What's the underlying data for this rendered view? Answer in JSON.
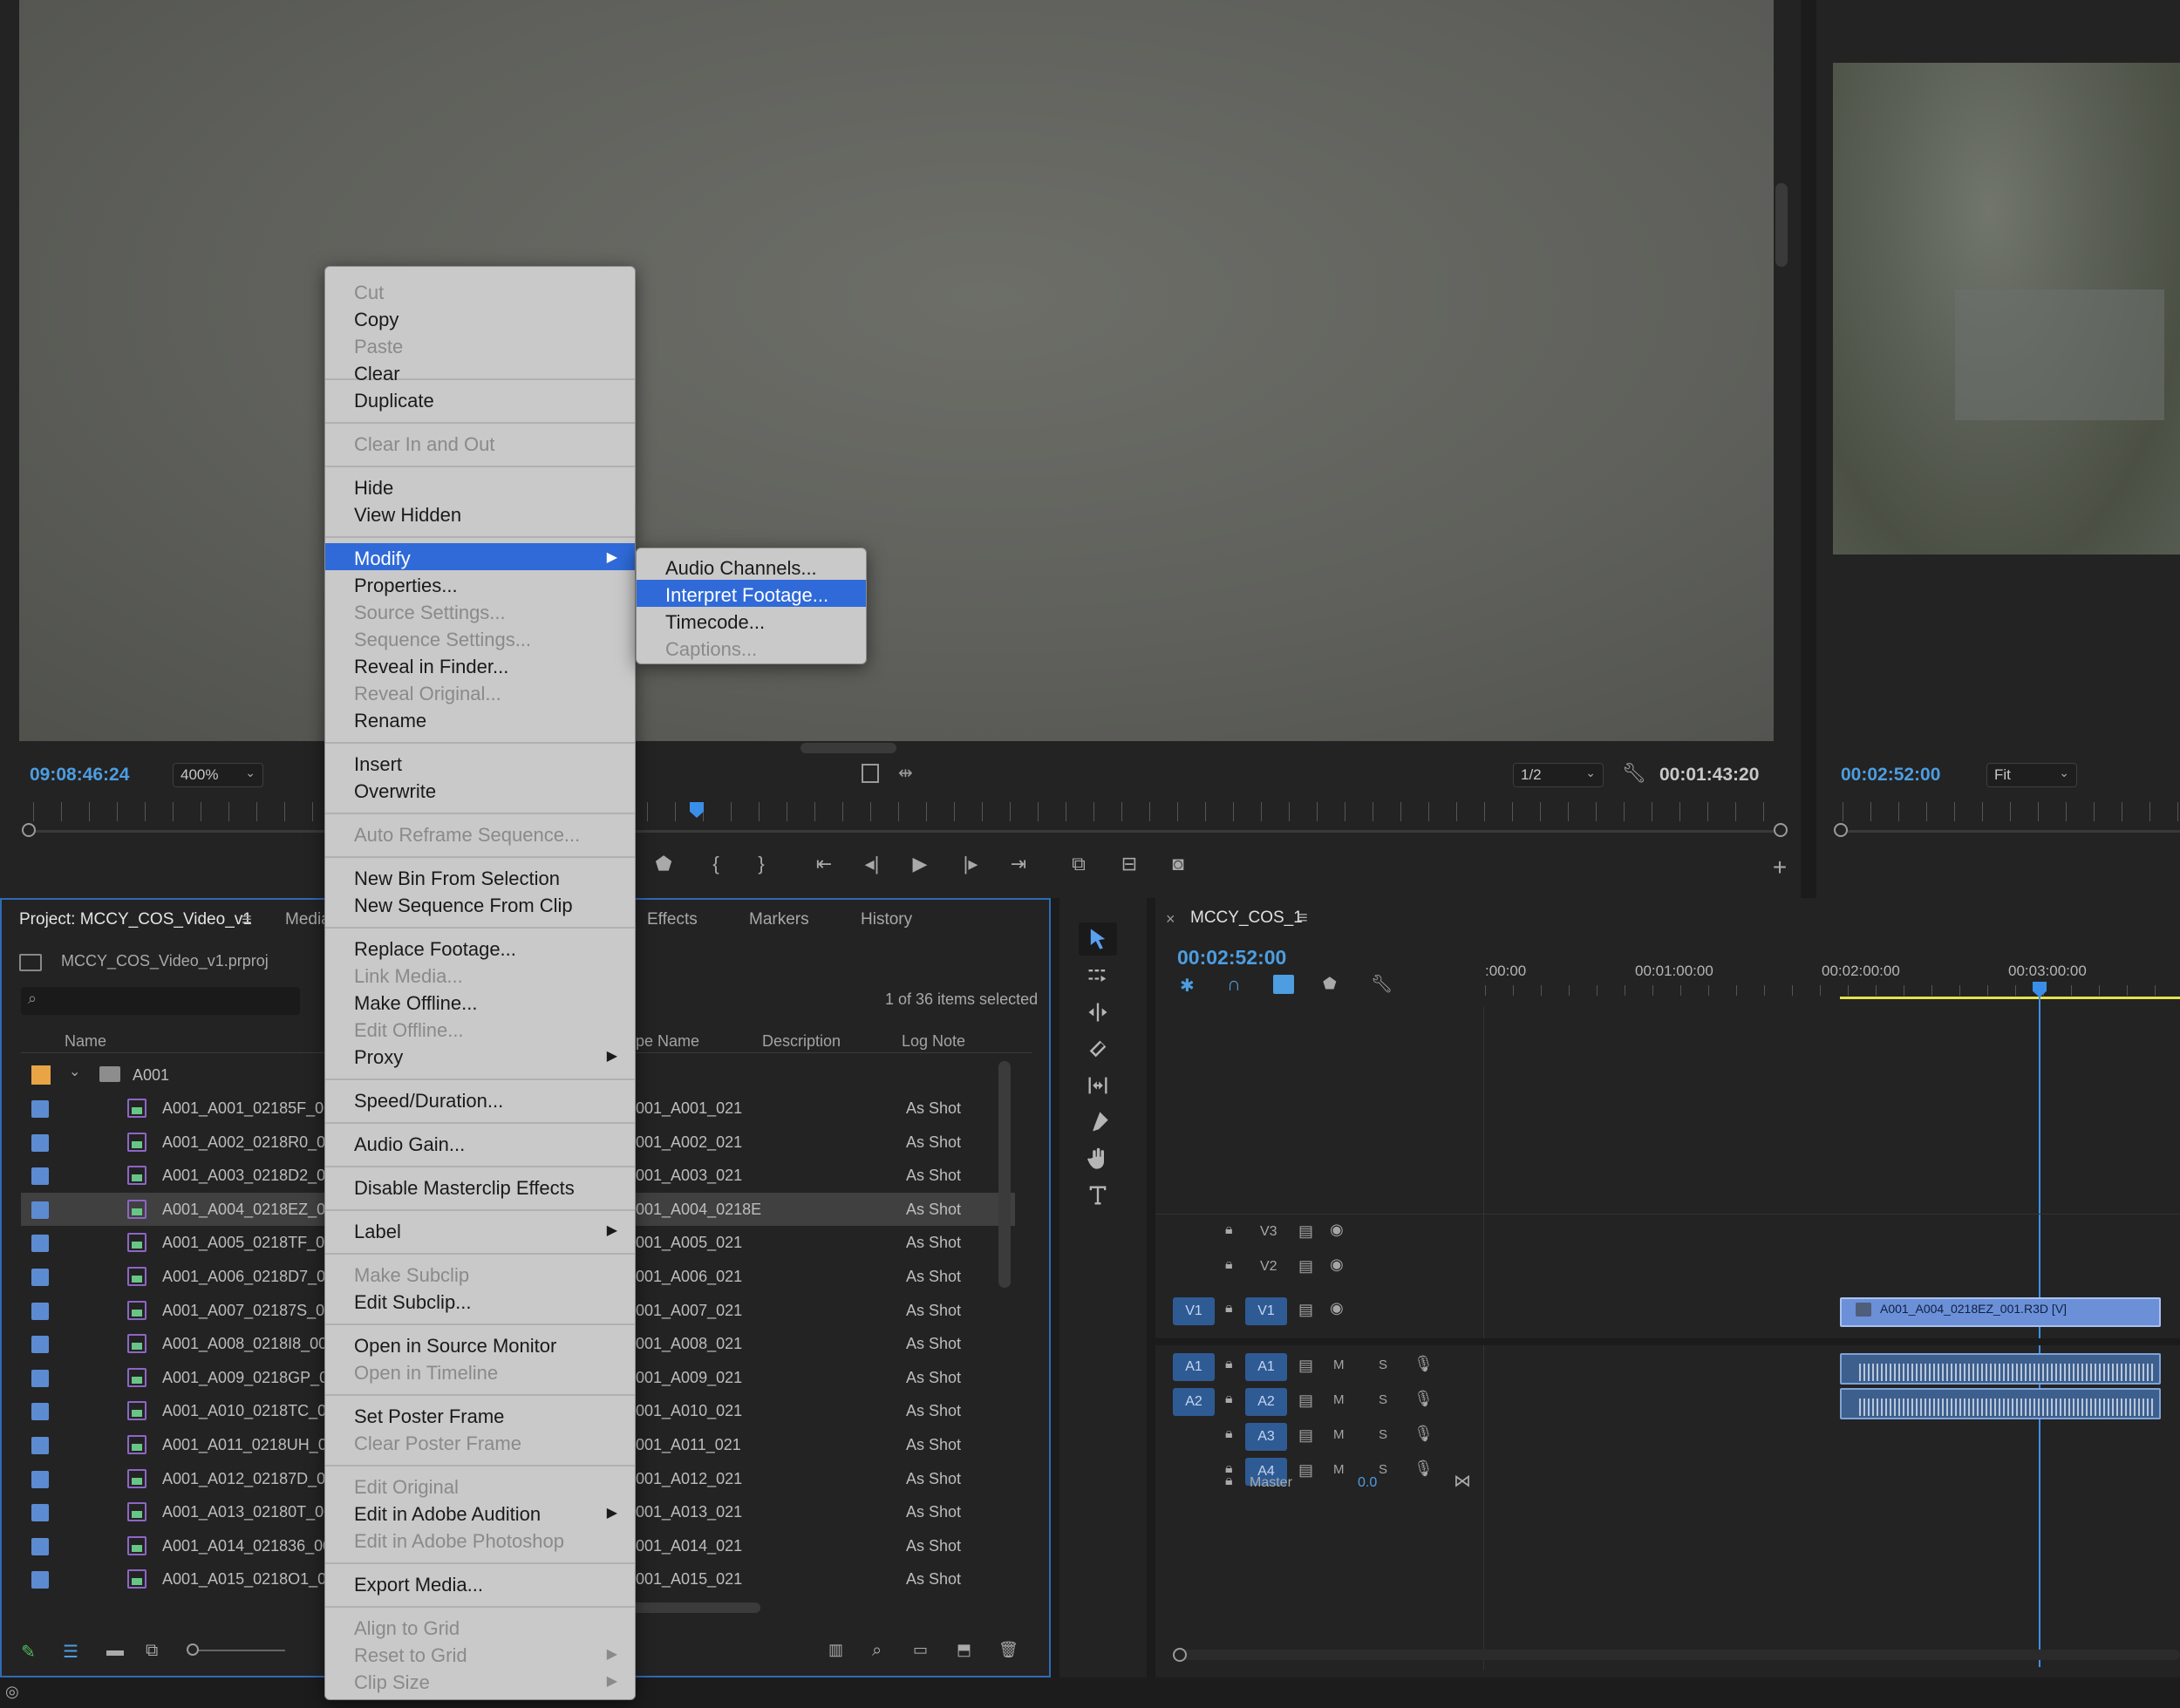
{
  "source_monitor": {
    "timecode_left": "09:08:46:24",
    "zoom": "400%",
    "resolution": "1/2",
    "timecode_right": "00:01:43:20"
  },
  "program_monitor": {
    "timecode": "00:02:52:00",
    "fit": "Fit"
  },
  "project": {
    "tabs": [
      "Project: MCCY_COS_Video_v1",
      "Media",
      "Effects",
      "Markers",
      "History"
    ],
    "file": "MCCY_COS_Video_v1.prproj",
    "search_placeholder": "",
    "selection_count": "1 of 36 items selected",
    "columns": {
      "name": "Name",
      "tape": "pe Name",
      "description": "Description",
      "log_note": "Log Note"
    },
    "folder": "A001",
    "rows": [
      {
        "name": "A001_A001_02185F_00",
        "tape": "001_A001_021",
        "log": "As Shot"
      },
      {
        "name": "A001_A002_0218R0_00",
        "tape": "001_A002_021",
        "log": "As Shot"
      },
      {
        "name": "A001_A003_0218D2_00",
        "tape": "001_A003_021",
        "log": "As Shot"
      },
      {
        "name": "A001_A004_0218EZ_00",
        "tape": "001_A004_0218E",
        "log": "As Shot"
      },
      {
        "name": "A001_A005_0218TF_00",
        "tape": "001_A005_021",
        "log": "As Shot"
      },
      {
        "name": "A001_A006_0218D7_00",
        "tape": "001_A006_021",
        "log": "As Shot"
      },
      {
        "name": "A001_A007_02187S_00",
        "tape": "001_A007_021",
        "log": "As Shot"
      },
      {
        "name": "A001_A008_0218I8_00",
        "tape": "001_A008_021",
        "log": "As Shot"
      },
      {
        "name": "A001_A009_0218GP_0",
        "tape": "001_A009_021",
        "log": "As Shot"
      },
      {
        "name": "A001_A010_0218TC_00",
        "tape": "001_A010_021",
        "log": "As Shot"
      },
      {
        "name": "A001_A011_0218UH_0",
        "tape": "001_A011_021",
        "log": "As Shot"
      },
      {
        "name": "A001_A012_02187D_00",
        "tape": "001_A012_021",
        "log": "As Shot"
      },
      {
        "name": "A001_A013_02180T_00",
        "tape": "001_A013_021",
        "log": "As Shot"
      },
      {
        "name": "A001_A014_021836_00",
        "tape": "001_A014_021",
        "log": "As Shot"
      },
      {
        "name": "A001_A015_0218O1_0",
        "tape": "001_A015_021",
        "log": "As Shot"
      }
    ]
  },
  "timeline": {
    "sequence": "MCCY_COS_1",
    "timecode": "00:02:52:00",
    "ruler": [
      ":00:00",
      "00:01:00:00",
      "00:02:00:00",
      "00:03:00:00"
    ],
    "video_tracks": [
      {
        "label": "V3"
      },
      {
        "label": "V2"
      },
      {
        "label": "V1",
        "src": "V1"
      }
    ],
    "audio_tracks": [
      {
        "label": "A1",
        "src": "A1"
      },
      {
        "label": "A2",
        "src": "A2"
      },
      {
        "label": "A3"
      },
      {
        "label": "A4"
      }
    ],
    "master": "Master",
    "master_value": "0.0",
    "clip_name": "A001_A004_0218EZ_001.R3D [V]",
    "mute": "M",
    "solo": "S"
  },
  "context_menu": {
    "items": [
      {
        "label": "Cut",
        "disabled": true
      },
      {
        "label": "Copy"
      },
      {
        "label": "Paste",
        "disabled": true
      },
      {
        "label": "Clear"
      },
      {
        "label": "Duplicate"
      },
      {
        "label": "Clear In and Out",
        "disabled": true
      },
      {
        "label": "Hide"
      },
      {
        "label": "View Hidden"
      },
      {
        "label": "Modify",
        "highlighted": true
      },
      {
        "label": "Properties..."
      },
      {
        "label": "Source Settings...",
        "disabled": true
      },
      {
        "label": "Sequence Settings...",
        "disabled": true
      },
      {
        "label": "Reveal in Finder..."
      },
      {
        "label": "Reveal Original...",
        "disabled": true
      },
      {
        "label": "Rename"
      },
      {
        "label": "Insert"
      },
      {
        "label": "Overwrite"
      },
      {
        "label": "Auto Reframe Sequence...",
        "disabled": true
      },
      {
        "label": "New Bin From Selection"
      },
      {
        "label": "New Sequence From Clip"
      },
      {
        "label": "Replace Footage..."
      },
      {
        "label": "Link Media...",
        "disabled": true
      },
      {
        "label": "Make Offline..."
      },
      {
        "label": "Edit Offline...",
        "disabled": true
      },
      {
        "label": "Proxy"
      },
      {
        "label": "Speed/Duration..."
      },
      {
        "label": "Audio Gain..."
      },
      {
        "label": "Disable Masterclip Effects"
      },
      {
        "label": "Label"
      },
      {
        "label": "Make Subclip",
        "disabled": true
      },
      {
        "label": "Edit Subclip..."
      },
      {
        "label": "Open in Source Monitor"
      },
      {
        "label": "Open in Timeline",
        "disabled": true
      },
      {
        "label": "Set Poster Frame"
      },
      {
        "label": "Clear Poster Frame",
        "disabled": true
      },
      {
        "label": "Edit Original",
        "disabled": true
      },
      {
        "label": "Edit in Adobe Audition"
      },
      {
        "label": "Edit in Adobe Photoshop",
        "disabled": true
      },
      {
        "label": "Export Media..."
      },
      {
        "label": "Align to Grid",
        "disabled": true
      },
      {
        "label": "Reset to Grid",
        "disabled": true
      },
      {
        "label": "Clip Size",
        "disabled": true
      }
    ],
    "submenu": [
      {
        "label": "Audio Channels..."
      },
      {
        "label": "Interpret Footage...",
        "highlighted": true
      },
      {
        "label": "Timecode..."
      },
      {
        "label": "Captions...",
        "disabled": true
      }
    ]
  },
  "colors": {
    "accent": "#2f6ad8",
    "timecode": "#4d9de0",
    "clip": "#6b90d8"
  }
}
